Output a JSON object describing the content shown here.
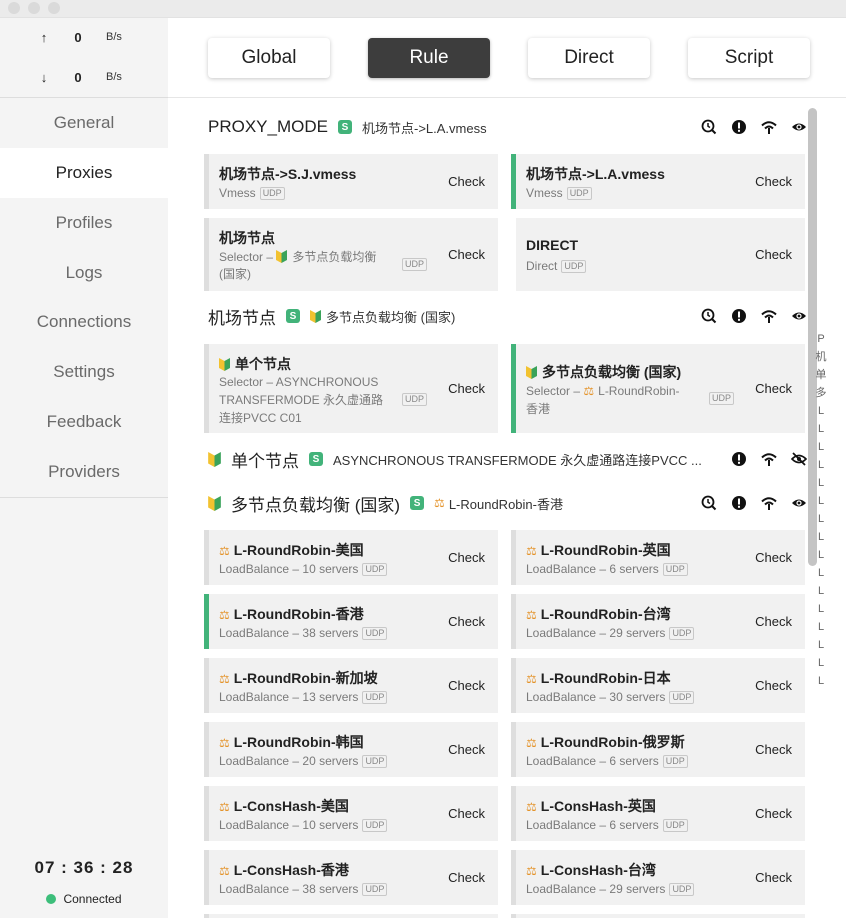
{
  "traffic": {
    "up_arrow": "↑",
    "up_value": "0",
    "up_unit": "B/s",
    "down_arrow": "↓",
    "down_value": "0",
    "down_unit": "B/s"
  },
  "nav": [
    "General",
    "Proxies",
    "Profiles",
    "Logs",
    "Connections",
    "Settings",
    "Feedback",
    "Providers"
  ],
  "active_nav": "Proxies",
  "clock": "07 : 36 : 28",
  "status": "Connected",
  "modes": [
    "Global",
    "Rule",
    "Direct",
    "Script"
  ],
  "active_mode": "Rule",
  "badge": "S",
  "check_label": "Check",
  "udp_label": "UDP",
  "groups": [
    {
      "name": "PROXY_MODE",
      "now": "机场节点->L.A.vmess"
    },
    {
      "name": "机场节点",
      "now": "多节点负载均衡 (国家)"
    },
    {
      "name": "单个节点",
      "now": "ASYNCHRONOUS TRANSFERMODE 永久虚通路连接PVCC ..."
    },
    {
      "name": "多节点负载均衡 (国家)",
      "now": "L-RoundRobin-香港"
    }
  ],
  "proxy_mode_cards": [
    {
      "name": "机场节点->S.J.vmess",
      "type": "Vmess"
    },
    {
      "name": "机场节点->L.A.vmess",
      "type": "Vmess"
    },
    {
      "name": "机场节点",
      "type_line1": "Selector – ",
      "type_now": "多节点负载均衡",
      "type_line2": "(国家)"
    },
    {
      "name": "DIRECT",
      "type": "Direct"
    }
  ],
  "airport_cards": [
    {
      "name": "单个节点",
      "type_line1": "Selector – ASYNCHRONOUS",
      "type_line2": "TRANSFERMODE 永久虚通路",
      "type_line3": "连接PVCC C01"
    },
    {
      "name": "多节点负载均衡 (国家)",
      "type_line1": "Selector – ",
      "type_now": "L-RoundRobin-",
      "type_line2": "香港"
    }
  ],
  "lb_cards": [
    {
      "name": "L-RoundRobin-美国",
      "type": "LoadBalance – 10 servers"
    },
    {
      "name": "L-RoundRobin-英国",
      "type": "LoadBalance – 6 servers"
    },
    {
      "name": "L-RoundRobin-香港",
      "type": "LoadBalance – 38 servers"
    },
    {
      "name": "L-RoundRobin-台湾",
      "type": "LoadBalance – 29 servers"
    },
    {
      "name": "L-RoundRobin-新加坡",
      "type": "LoadBalance – 13 servers"
    },
    {
      "name": "L-RoundRobin-日本",
      "type": "LoadBalance – 30 servers"
    },
    {
      "name": "L-RoundRobin-韩国",
      "type": "LoadBalance – 20 servers"
    },
    {
      "name": "L-RoundRobin-俄罗斯",
      "type": "LoadBalance – 6 servers"
    },
    {
      "name": "L-ConsHash-美国",
      "type": "LoadBalance – 10 servers"
    },
    {
      "name": "L-ConsHash-英国",
      "type": "LoadBalance – 6 servers"
    },
    {
      "name": "L-ConsHash-香港",
      "type": "LoadBalance – 38 servers"
    },
    {
      "name": "L-ConsHash-台湾",
      "type": "LoadBalance – 29 servers"
    }
  ],
  "right_index": [
    "P",
    "机",
    "单",
    "多",
    "L",
    "L",
    "L",
    "L",
    "L",
    "L",
    "L",
    "L",
    "L",
    "L",
    "L",
    "L",
    "L",
    "L",
    "L",
    "L"
  ],
  "colors": {
    "accent": "#42b37a",
    "mode_active": "#3d3d3d",
    "lb_icon": "#e4932a"
  }
}
